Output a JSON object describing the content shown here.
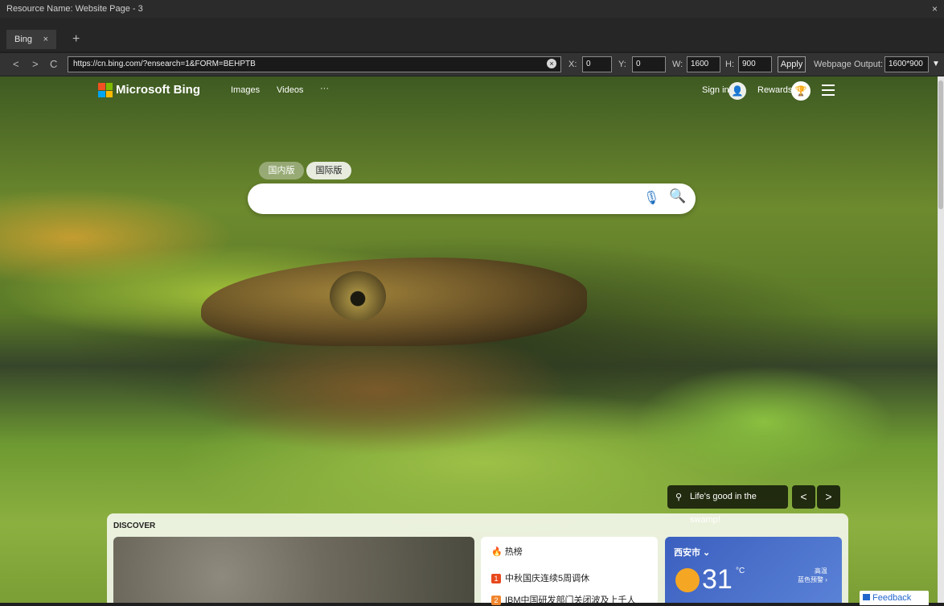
{
  "window": {
    "title": "Resource Name: Website Page - 3",
    "close_glyph": "×"
  },
  "tabs": [
    {
      "label": "Bing",
      "close_glyph": "×"
    }
  ],
  "new_tab_glyph": "+",
  "toolbar": {
    "back_glyph": "<",
    "forward_glyph": ">",
    "reload_glyph": "C",
    "url": "https://cn.bing.com/?ensearch=1&FORM=BEHPTB",
    "clear_glyph": "×",
    "x_label": "X:",
    "x_value": "0",
    "y_label": "Y:",
    "y_value": "0",
    "w_label": "W:",
    "w_value": "1600",
    "h_label": "H:",
    "h_value": "900",
    "apply_label": "Apply",
    "output_label": "Webpage Output:",
    "output_value": "1600*900",
    "dropdown_glyph": "▼"
  },
  "bing": {
    "brand": "Microsoft Bing",
    "nav": [
      "Images",
      "Videos",
      "···"
    ],
    "sign_in": "Sign in",
    "avatar_glyph": "👤",
    "rewards": "Rewards",
    "trophy_glyph": "🏆",
    "region_tabs": [
      "国内版",
      "国际版"
    ],
    "search_value": "",
    "mic_glyph": "🎙",
    "search_glyph": "🔍",
    "image_caption": "Life's good in the swamp!",
    "pin_glyph": "⚲",
    "prev_glyph": "<",
    "next_glyph": ">"
  },
  "discover": {
    "title": "DISCOVER",
    "hot": {
      "title": "热榜",
      "items": [
        {
          "rank": "1",
          "text": "中秋国庆连续5周调休"
        },
        {
          "rank": "2",
          "text": "IBM中国研发部门关闭波及上千人"
        }
      ]
    },
    "weather": {
      "city": "西安市 ⌄",
      "temperature": "31",
      "unit": "°C",
      "alert": "高温\n蓝色预警"
    }
  },
  "feedback_label": "Feedback",
  "colors": {
    "accent": "#1a6dbd",
    "hot_rank_1": "#e8491d",
    "hot_rank_2": "#f0862e"
  }
}
